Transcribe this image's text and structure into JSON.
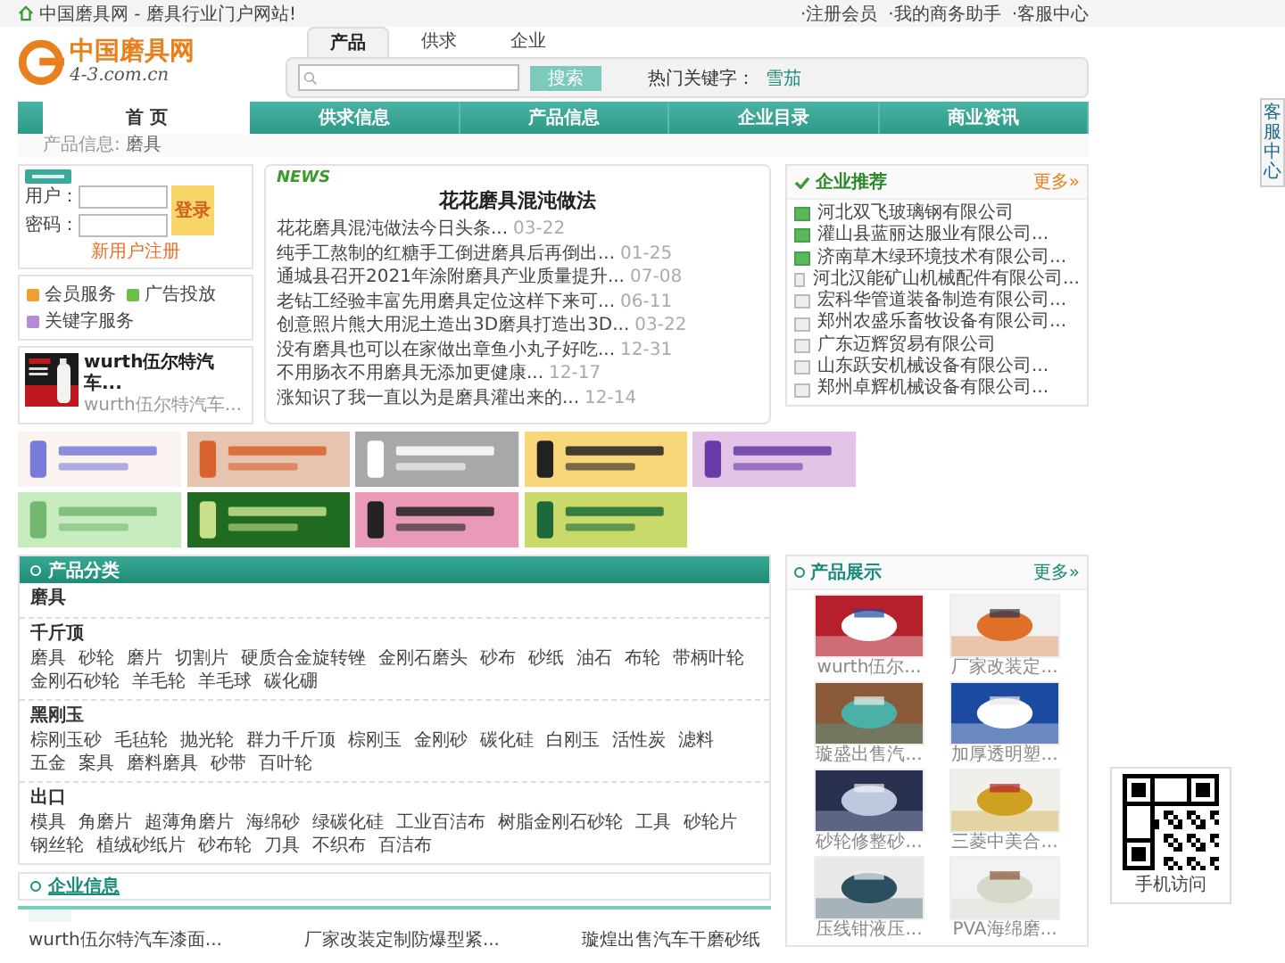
{
  "top_bar": {
    "welcome": "中国磨具网 - 磨具行业门户网站!",
    "links": [
      "·注册会员",
      "·我的商务助手",
      "·客服中心"
    ]
  },
  "logo": {
    "name": "中国磨具网",
    "domain": "4-3.com.cn"
  },
  "search": {
    "tabs": [
      {
        "label": "产品",
        "selected": true
      },
      {
        "label": "供求",
        "selected": false
      },
      {
        "label": "企业",
        "selected": false
      }
    ],
    "button": "搜索",
    "hot_label": "热门关键字：",
    "hot_keyword": "雪茄"
  },
  "nav": [
    {
      "label": "首 页",
      "selected": true
    },
    {
      "label": "供求信息",
      "selected": false
    },
    {
      "label": "产品信息",
      "selected": false
    },
    {
      "label": "企业目录",
      "selected": false
    },
    {
      "label": "商业资讯",
      "selected": false
    }
  ],
  "breadcrumb": {
    "label": "产品信息:",
    "current": "磨具"
  },
  "login": {
    "user_label": "用户：",
    "password_label": "密码：",
    "button": "登录",
    "register": "新用户注册"
  },
  "services": [
    {
      "label": "会员服务",
      "color": "#f0a030"
    },
    {
      "label": "广告投放",
      "color": "#6cbf4a"
    },
    {
      "label": "关键字服务",
      "color": "#b58ad6"
    }
  ],
  "promo": {
    "title": "wurth伍尔特汽车...",
    "subtitle": "wurth伍尔特汽车..."
  },
  "news": {
    "tag": "NEWS",
    "title": "花花磨具混沌做法",
    "items": [
      {
        "text": "花花磨具混沌做法今日头条...",
        "date": "03-22"
      },
      {
        "text": "纯手工熬制的红糖手工倒进磨具后再倒出...",
        "date": "01-25"
      },
      {
        "text": "通城县召开2021年涂附磨具产业质量提升...",
        "date": "07-08"
      },
      {
        "text": "老钻工经验丰富先用磨具定位这样下来可...",
        "date": "06-11"
      },
      {
        "text": "创意照片熊大用泥土造出3D磨具打造出3D...",
        "date": "03-22"
      },
      {
        "text": "没有磨具也可以在家做出章鱼小丸子好吃...",
        "date": "12-31"
      },
      {
        "text": "不用肠衣不用磨具无添加更健康...",
        "date": "12-17"
      },
      {
        "text": "涨知识了我一直以为是磨具灌出来的...",
        "date": "12-14"
      }
    ]
  },
  "companies": {
    "title": "企业推荐",
    "more": "更多»",
    "items": [
      {
        "name": "河北双飞玻璃钢有限公司",
        "featured": true
      },
      {
        "name": "灌山县蓝丽达服业有限公司...",
        "featured": true
      },
      {
        "name": "济南草木绿环境技术有限公司...",
        "featured": true
      },
      {
        "name": "河北汉能矿山机械配件有限公司...",
        "featured": false
      },
      {
        "name": "宏科华管道装备制造有限公司...",
        "featured": false
      },
      {
        "name": "郑州农盛乐畜牧设备有限公司...",
        "featured": false
      },
      {
        "name": "广东迈辉贸易有限公司",
        "featured": false
      },
      {
        "name": "山东跃安机械设备有限公司...",
        "featured": false
      },
      {
        "name": "郑州卓辉机械设备有限公司...",
        "featured": false
      }
    ]
  },
  "categories": {
    "title": "产品分类",
    "groups": [
      {
        "name": "磨具"
      },
      {
        "name": "千斤顶",
        "items": [
          "磨具",
          "砂轮",
          "磨片",
          "切割片",
          "硬质合金旋转锉",
          "金刚石磨头",
          "砂布",
          "砂纸",
          "油石",
          "布轮",
          "带柄叶轮",
          "金刚石砂轮",
          "羊毛轮",
          "羊毛球",
          "碳化硼"
        ]
      },
      {
        "name": "黑刚玉",
        "items": [
          "棕刚玉砂",
          "毛毡轮",
          "抛光轮",
          "群力千斤顶",
          "棕刚玉",
          "金刚砂",
          "碳化硅",
          "白刚玉",
          "活性炭",
          "滤料",
          "五金",
          "案具",
          "磨料磨具",
          "砂带",
          "百叶轮"
        ]
      },
      {
        "name": "出口",
        "items": [
          "模具",
          "角磨片",
          "超薄角磨片",
          "海绵砂",
          "绿碳化硅",
          "工业百洁布",
          "树脂金刚石砂轮",
          "工具",
          "砂轮片",
          "钢丝轮",
          "植绒砂纸片",
          "砂布轮",
          "刀具",
          "不织布",
          "百洁布"
        ]
      }
    ]
  },
  "company_info": {
    "title": "企业信息",
    "items": [
      "wurth伍尔特汽车漆面...",
      "厂家改装定制防爆型紧...",
      "璇煌出售汽车干磨砂纸"
    ]
  },
  "products": {
    "title": "产品展示",
    "more": "更多»",
    "items": [
      {
        "caption": "wurth伍尔..."
      },
      {
        "caption": "厂家改装定..."
      },
      {
        "caption": "璇盛出售汽..."
      },
      {
        "caption": "加厚透明塑..."
      },
      {
        "caption": "砂轮修整砂..."
      },
      {
        "caption": "三菱中美合..."
      },
      {
        "caption": "压线钳液压..."
      },
      {
        "caption": "PVA海绵磨..."
      }
    ]
  },
  "qr": {
    "caption": "手机访问"
  },
  "side_tab": {
    "label": "客服中心"
  }
}
